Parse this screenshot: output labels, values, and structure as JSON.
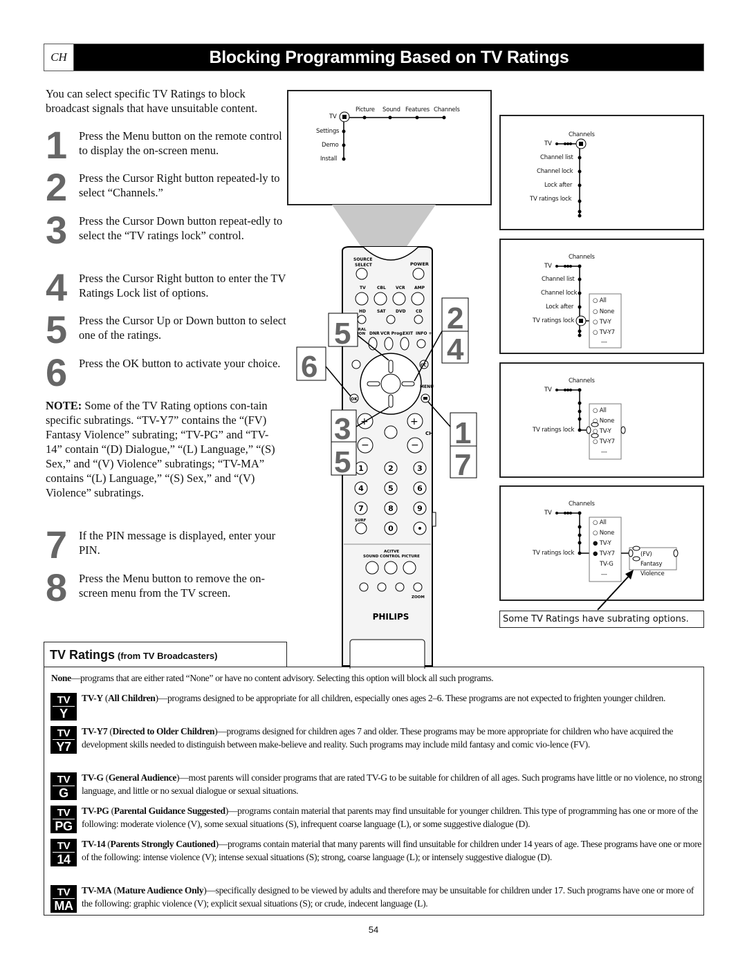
{
  "header": {
    "section_tag": "CH",
    "title": "Blocking Programming Based on TV Ratings"
  },
  "intro": "You can select specific TV Ratings to block broadcast signals that have unsuitable content.",
  "steps": [
    {
      "number": "1",
      "text": "Press the Menu button on the remote control to display the on-screen menu."
    },
    {
      "number": "2",
      "text": "Press the Cursor Right button repeated-ly to select “Channels.”"
    },
    {
      "number": "3",
      "text": "Press the Cursor Down button repeat-edly to select the “TV ratings lock” control."
    },
    {
      "number": "4",
      "text": "Press the Cursor Right button to enter the TV Ratings Lock list of options."
    },
    {
      "number": "5",
      "text": "Press the Cursor Up or Down button to select one of the ratings."
    },
    {
      "number": "6",
      "text": "Press the OK button to activate your choice."
    },
    {
      "number": "7",
      "text": "If the PIN message is displayed, enter your PIN."
    },
    {
      "number": "8",
      "text": "Press the Menu button to remove the on-screen menu from the TV screen."
    }
  ],
  "note": {
    "label": "NOTE:",
    "text": " Some of the TV Rating options con-tain specific subratings. “TV-Y7” contains the “(FV) Fantasy Violence” subrating; “TV-PG” and “TV-14” contain “(D) Dialogue,” “(L) Language,” “(S) Sex,” and “(V) Violence” subratings; “TV-MA” contains “(L) Language,” “(S) Sex,” and “(V) Violence” subratings."
  },
  "screens": {
    "main_menu": {
      "root": "TV",
      "top_items": [
        "Picture",
        "Sound",
        "Features",
        "Channels"
      ],
      "side_items": [
        "Settings",
        "Demo",
        "Install"
      ]
    },
    "channels_menu": {
      "root": "TV",
      "title": "Channels",
      "items": [
        "Channel list",
        "Channel lock",
        "Lock after",
        "TV ratings lock"
      ]
    },
    "ratings_list": {
      "root": "TV",
      "title": "Channels",
      "items": [
        "Channel list",
        "Channel lock",
        "Lock after",
        "TV ratings lock"
      ],
      "options": [
        "All",
        "None",
        "TV-Y",
        "TV-Y7",
        "---"
      ]
    },
    "ratings_select": {
      "root": "TV",
      "title": "Channels",
      "active_item": "TV ratings lock",
      "options": [
        "All",
        "None",
        "TV-Y",
        "TV-Y7",
        "---"
      ]
    },
    "subratings": {
      "root": "TV",
      "title": "Channels",
      "active_item": "TV ratings lock",
      "options": [
        {
          "label": "All",
          "checked": false
        },
        {
          "label": "None",
          "checked": false
        },
        {
          "label": "TV-Y",
          "checked": true
        },
        {
          "label": "TV-Y7",
          "checked": true
        },
        {
          "label": "TV-G",
          "checked": null
        },
        {
          "label": "---",
          "checked": null
        }
      ],
      "subrating": "(FV) Fantasy Violence"
    },
    "caption": "Some TV Ratings have subrating options."
  },
  "remote": {
    "brand": "PHILIPS",
    "labels": {
      "source_select": "SOURCE SELECT",
      "power": "POWER",
      "tv": "TV",
      "cbl": "CBL",
      "vcr": "VCR",
      "amp": "AMP",
      "hd": "HD",
      "sat": "SAT",
      "dvd": "DVD",
      "cd": "CD",
      "natural_motion": "URAL TION",
      "dnr": "DNR",
      "vcr_prog": "VCR Prog.",
      "exit": "EXIT",
      "info": "INFO +",
      "cc": "CC",
      "ok": "OK",
      "menu": "MENU",
      "ch": "CH",
      "surf": "SURF",
      "active_control": "ACITVE",
      "sound": "SOUND",
      "control": "CONTROL",
      "picture": "PICTURE",
      "zoom": "ZOOM"
    },
    "digits": [
      "1",
      "2",
      "3",
      "4",
      "5",
      "6",
      "7",
      "8",
      "9",
      "0"
    ],
    "callouts": [
      "5",
      "2",
      "4",
      "6",
      "3",
      "5",
      "1",
      "7"
    ]
  },
  "ratings": {
    "heading": "TV Ratings",
    "subheading": "(from TV Broadcasters)",
    "items": [
      {
        "badge_top": "",
        "badge_bottom": "",
        "code": "None",
        "name": "",
        "desc": "—programs that are either rated “None” or have no content advisory. Selecting this option will block all such programs."
      },
      {
        "badge_top": "TV",
        "badge_bottom": "Y",
        "code": "TV-Y",
        "name": "All Children",
        "desc": "—programs designed to be appropriate for all children, especially ones ages 2–6. These programs are not expected to frighten younger children."
      },
      {
        "badge_top": "TV",
        "badge_bottom": "Y7",
        "code": "TV-Y7",
        "name": "Directed to Older Children",
        "desc": "—programs designed for children ages 7 and older. These programs may be more appropriate for children who have acquired the development skills needed to distinguish between make-believe and reality. Such programs may include mild fantasy and comic vio-lence (FV)."
      },
      {
        "badge_top": "TV",
        "badge_bottom": "G",
        "code": "TV-G",
        "name": "General Audience",
        "desc": "—most parents will consider programs that are rated TV-G to be suitable for children of all ages. Such programs have little or no violence, no strong language, and little or no sexual dialogue or sexual situations."
      },
      {
        "badge_top": "TV",
        "badge_bottom": "PG",
        "code": "TV-PG",
        "name": "Parental Guidance Suggested",
        "desc": "—programs contain material that parents may find unsuitable for younger children. This type of programming has one or more of the following: moderate violence (V), some sexual situations (S), infrequent coarse language (L), or some suggestive dialogue (D)."
      },
      {
        "badge_top": "TV",
        "badge_bottom": "14",
        "code": "TV-14",
        "name": "Parents Strongly Cautioned",
        "desc": "—programs contain material that many parents will find unsuitable for children under 14 years of age. These programs have one or more of the following: intense violence (V); intense sexual situations (S); strong, coarse language (L); or intensely suggestive dialogue (D)."
      },
      {
        "badge_top": "TV",
        "badge_bottom": "MA",
        "code": "TV-MA",
        "name": "Mature Audience Only",
        "desc": "—specifically designed to be viewed by adults and therefore may be unsuitable for children under 17. Such programs have one or more of the following: graphic violence (V); explicit sexual situations (S); or crude, indecent language (L)."
      }
    ]
  },
  "page_number": "54"
}
